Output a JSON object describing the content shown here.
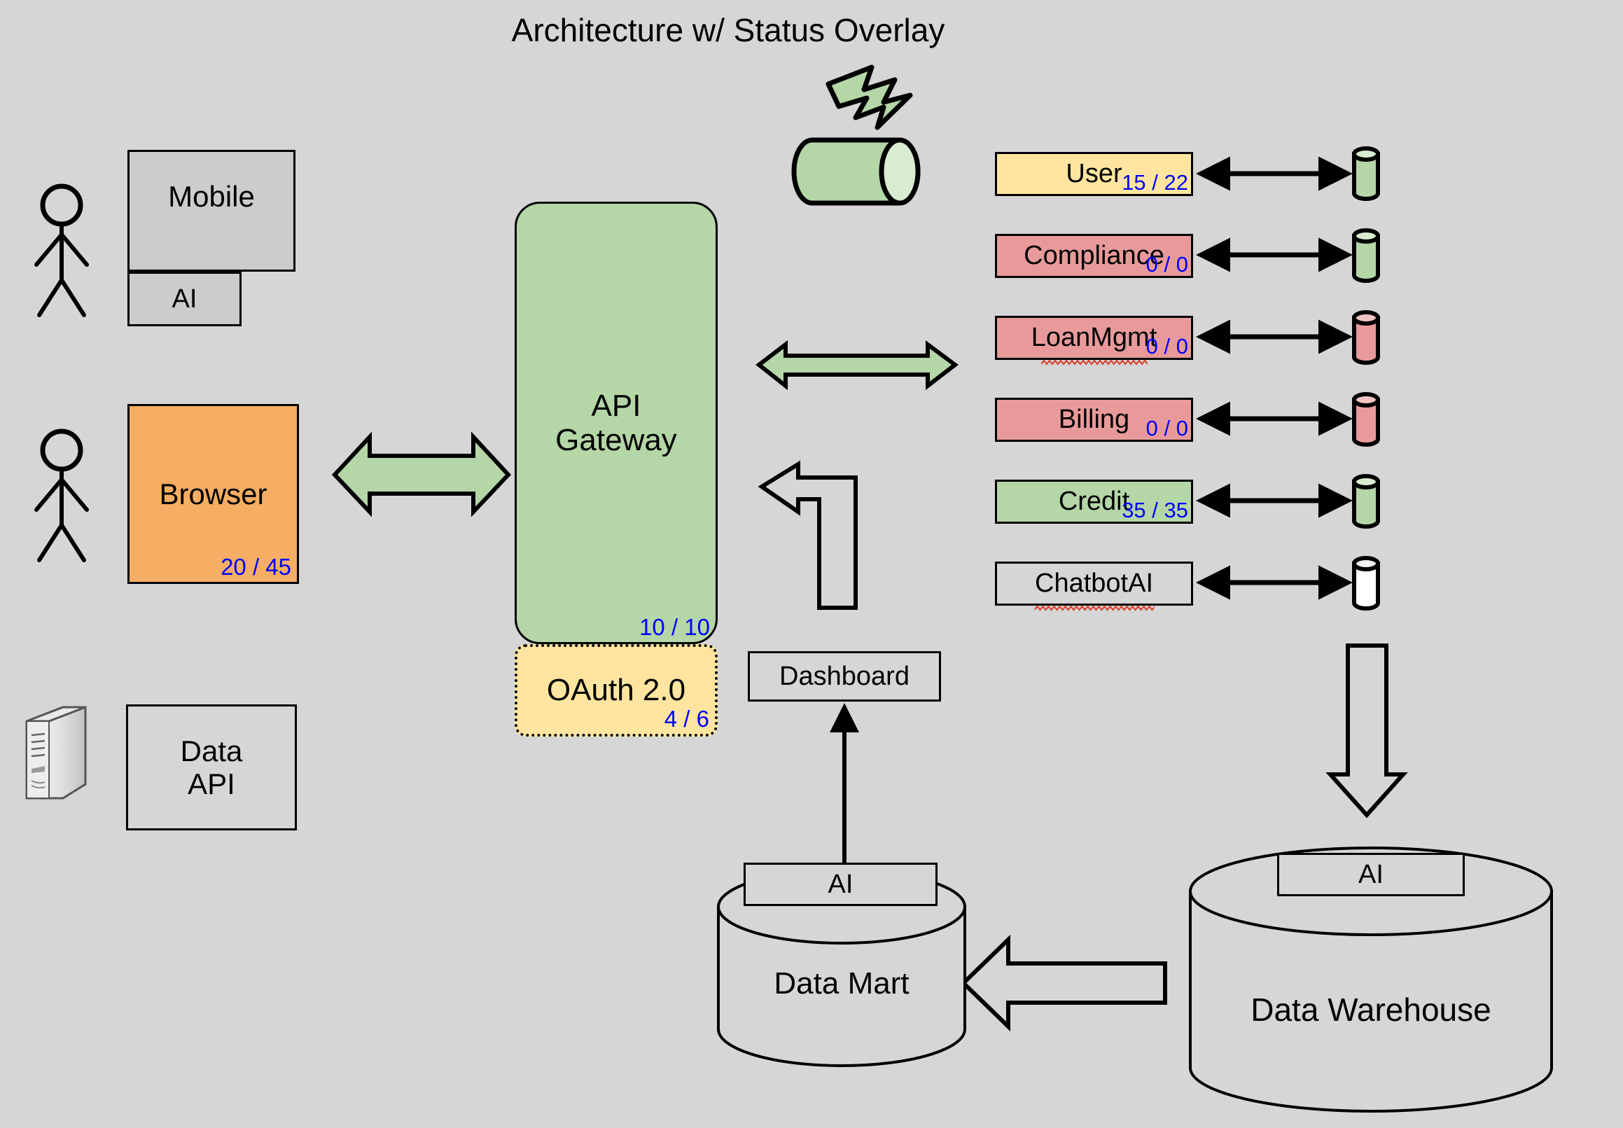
{
  "title": "Architecture w/ Status Overlay",
  "colors": {
    "background": "#d6d6d6",
    "green_ok": "#b5d6a7",
    "red_fail": "#e89a9a",
    "yellow_warn": "#ffe5a0",
    "orange": "#f5ae63",
    "gray": "#cccccc",
    "white": "#ffffff",
    "status_text": "#0000ff",
    "stroke": "#000000"
  },
  "clients": {
    "mobile": {
      "label": "Mobile",
      "nested_label": "AI",
      "fill": "#cccccc"
    },
    "browser": {
      "label": "Browser",
      "status": "20 / 45",
      "fill": "#f5ae63"
    },
    "data_api": {
      "label_line1": "Data",
      "label_line2": "API",
      "fill": "none"
    },
    "actor_icon": "stick-figure-actor-icon",
    "server_icon": "tower-server-icon"
  },
  "gateway": {
    "label_line1": "API",
    "label_line2": "Gateway",
    "status": "10 / 10",
    "fill": "#b5d6a7"
  },
  "oauth": {
    "label": "OAuth 2.0",
    "status": "4 / 6",
    "fill": "#ffe5a0"
  },
  "dashboard": {
    "label": "Dashboard"
  },
  "overlay": {
    "bolt_icon": "lightning-bolt-icon",
    "bolt_fill": "#b5d6a7",
    "cylinder_icon": "horizontal-cylinder-icon",
    "cylinder_fill": "#b5d6a7"
  },
  "services": [
    {
      "label": "User",
      "status": "15 / 22",
      "fill": "#ffe5a0",
      "db_fill": "#b5d6a7",
      "spellcheck": false
    },
    {
      "label": "Compliance",
      "status": "0 / 0",
      "fill": "#e89a9a",
      "db_fill": "#b5d6a7",
      "spellcheck": false
    },
    {
      "label": "LoanMgmt",
      "status": "0 / 0",
      "fill": "#e89a9a",
      "db_fill": "#e89a9a",
      "spellcheck": true
    },
    {
      "label": "Billing",
      "status": "0 / 0",
      "fill": "#e89a9a",
      "db_fill": "#e89a9a",
      "spellcheck": false
    },
    {
      "label": "Credit",
      "status": "35 / 35",
      "fill": "#b5d6a7",
      "db_fill": "#b5d6a7",
      "spellcheck": false
    },
    {
      "label": "ChatbotAI",
      "status": "",
      "fill": "none",
      "db_fill": "#ffffff",
      "spellcheck": true
    }
  ],
  "data_layer": {
    "data_mart": {
      "label": "Data Mart",
      "ai_label": "AI"
    },
    "data_warehouse": {
      "label": "Data Warehouse",
      "ai_label": "AI"
    }
  },
  "arrows": {
    "browser_to_gateway": "green-bidirectional-arrow",
    "gateway_to_services": "green-bidirectional-arrow",
    "services_to_gateway": "hollow-elbow-arrow-left",
    "service_db_link": "black-bidirectional-arrow",
    "services_to_warehouse": "hollow-down-arrow",
    "warehouse_to_mart": "hollow-left-arrow",
    "mart_to_dashboard": "thin-up-arrow"
  }
}
